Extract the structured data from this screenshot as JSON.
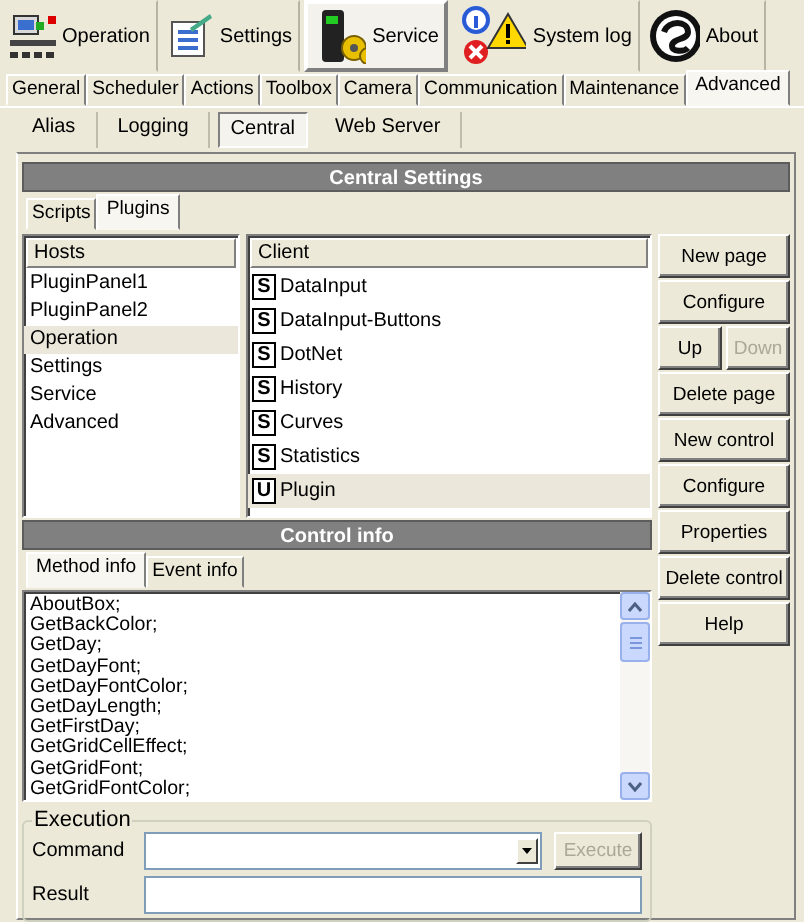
{
  "toolbar": [
    {
      "label": "Operation",
      "selected": false
    },
    {
      "label": "Settings",
      "selected": false
    },
    {
      "label": "Service",
      "selected": true
    },
    {
      "label": "System log",
      "selected": false
    },
    {
      "label": "About",
      "selected": false
    }
  ],
  "tabs": [
    {
      "label": "General",
      "selected": false
    },
    {
      "label": "Scheduler",
      "selected": false
    },
    {
      "label": "Actions",
      "selected": false
    },
    {
      "label": "Toolbox",
      "selected": false
    },
    {
      "label": "Camera",
      "selected": false
    },
    {
      "label": "Communication",
      "selected": false
    },
    {
      "label": "Maintenance",
      "selected": false
    },
    {
      "label": "Advanced",
      "selected": true
    }
  ],
  "subtabs": [
    {
      "label": "Alias",
      "selected": false
    },
    {
      "label": "Logging",
      "selected": false
    },
    {
      "label": "Central",
      "selected": true
    },
    {
      "label": "Web Server",
      "selected": false
    }
  ],
  "panel_title": "Central Settings",
  "inner_tabs": [
    {
      "label": "Scripts",
      "selected": false
    },
    {
      "label": "Plugins",
      "selected": true
    }
  ],
  "hosts": {
    "header": "Hosts",
    "items": [
      {
        "label": "PluginPanel1",
        "selected": false
      },
      {
        "label": "PluginPanel2",
        "selected": false
      },
      {
        "label": "Operation",
        "selected": true
      },
      {
        "label": "Settings",
        "selected": false
      },
      {
        "label": "Service",
        "selected": false
      },
      {
        "label": "Advanced",
        "selected": false
      }
    ]
  },
  "client": {
    "header": "Client",
    "items": [
      {
        "badge": "S",
        "label": "DataInput",
        "selected": false
      },
      {
        "badge": "S",
        "label": "DataInput-Buttons",
        "selected": false
      },
      {
        "badge": "S",
        "label": "DotNet",
        "selected": false
      },
      {
        "badge": "S",
        "label": "History",
        "selected": false
      },
      {
        "badge": "S",
        "label": "Curves",
        "selected": false
      },
      {
        "badge": "S",
        "label": "Statistics",
        "selected": false
      },
      {
        "badge": "U",
        "label": "Plugin",
        "selected": true
      }
    ]
  },
  "buttons": [
    {
      "kind": "full",
      "label": "New page",
      "disabled": false
    },
    {
      "kind": "full",
      "label": "Configure",
      "disabled": false
    },
    {
      "kind": "half",
      "label": "Up",
      "disabled": false
    },
    {
      "kind": "half",
      "label": "Down",
      "disabled": true
    },
    {
      "kind": "full",
      "label": "Delete page",
      "disabled": false
    },
    {
      "kind": "full",
      "label": "New control",
      "disabled": false
    },
    {
      "kind": "full",
      "label": "Configure",
      "disabled": false
    },
    {
      "kind": "full",
      "label": "Properties",
      "disabled": false
    },
    {
      "kind": "full",
      "label": "Delete control",
      "disabled": false
    },
    {
      "kind": "full",
      "label": "Help",
      "disabled": false
    }
  ],
  "control_info": {
    "title": "Control info",
    "tabs": [
      {
        "label": "Method info",
        "selected": true
      },
      {
        "label": "Event info",
        "selected": false
      }
    ],
    "methods": [
      "AboutBox;",
      "GetBackColor;",
      "GetDay;",
      "GetDayFont;",
      "GetDayFontColor;",
      "GetDayLength;",
      "GetFirstDay;",
      "GetGridCellEffect;",
      "GetGridFont;",
      "GetGridFontColor;"
    ]
  },
  "execution": {
    "legend": "Execution",
    "command_label": "Command",
    "result_label": "Result",
    "execute": {
      "label": "Execute",
      "disabled": true
    }
  }
}
